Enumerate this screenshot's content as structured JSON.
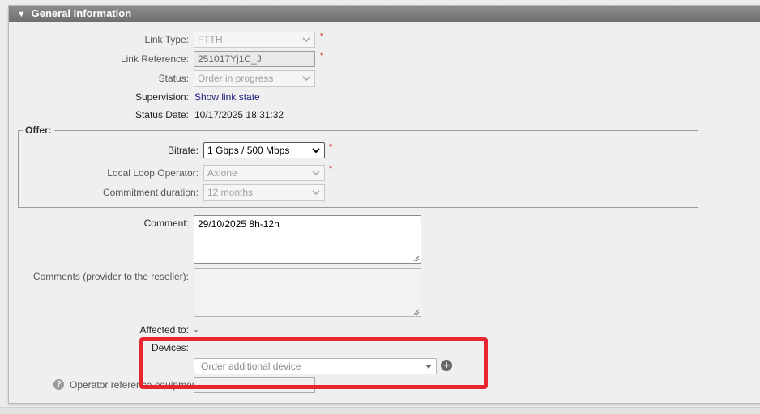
{
  "panel": {
    "title": "General Information",
    "toggle_icon": "triangle-down-icon"
  },
  "fields": {
    "link_type": {
      "label": "Link Type:",
      "value": "FTTH",
      "required": "*"
    },
    "link_reference": {
      "label": "Link Reference:",
      "value": "251017Yj1C_J",
      "required": "*"
    },
    "status": {
      "label": "Status:",
      "value": "Order in progress"
    },
    "supervision": {
      "label": "Supervision:",
      "link_text": "Show link state"
    },
    "status_date": {
      "label": "Status Date:",
      "value": "10/17/2025 18:31:32"
    }
  },
  "offer": {
    "legend": "Offer:",
    "bitrate": {
      "label": "Bitrate:",
      "value": "1 Gbps / 500 Mbps",
      "required": "*"
    },
    "local_loop_operator": {
      "label": "Local Loop Operator:",
      "value": "Axione",
      "required": "*"
    },
    "commitment_duration": {
      "label": "Commitment duration:",
      "value": "12 months"
    }
  },
  "comment": {
    "label": "Comment:",
    "value": "29/10/2025 8h-12h"
  },
  "comments_provider": {
    "label": "Comments (provider to the reseller):",
    "value": ""
  },
  "affected_to": {
    "label": "Affected to:",
    "value": "-"
  },
  "devices": {
    "label": "Devices:",
    "placeholder": "Order additional device",
    "add_icon": "plus-circle-icon"
  },
  "operator_reference": {
    "label": "Operator reference equipment",
    "help_icon": "question-circle-icon",
    "value": ""
  },
  "colors": {
    "highlight": "#e8242e",
    "header": "#7d7d7d",
    "required": "#d00000",
    "link": "#1a1a7a"
  }
}
